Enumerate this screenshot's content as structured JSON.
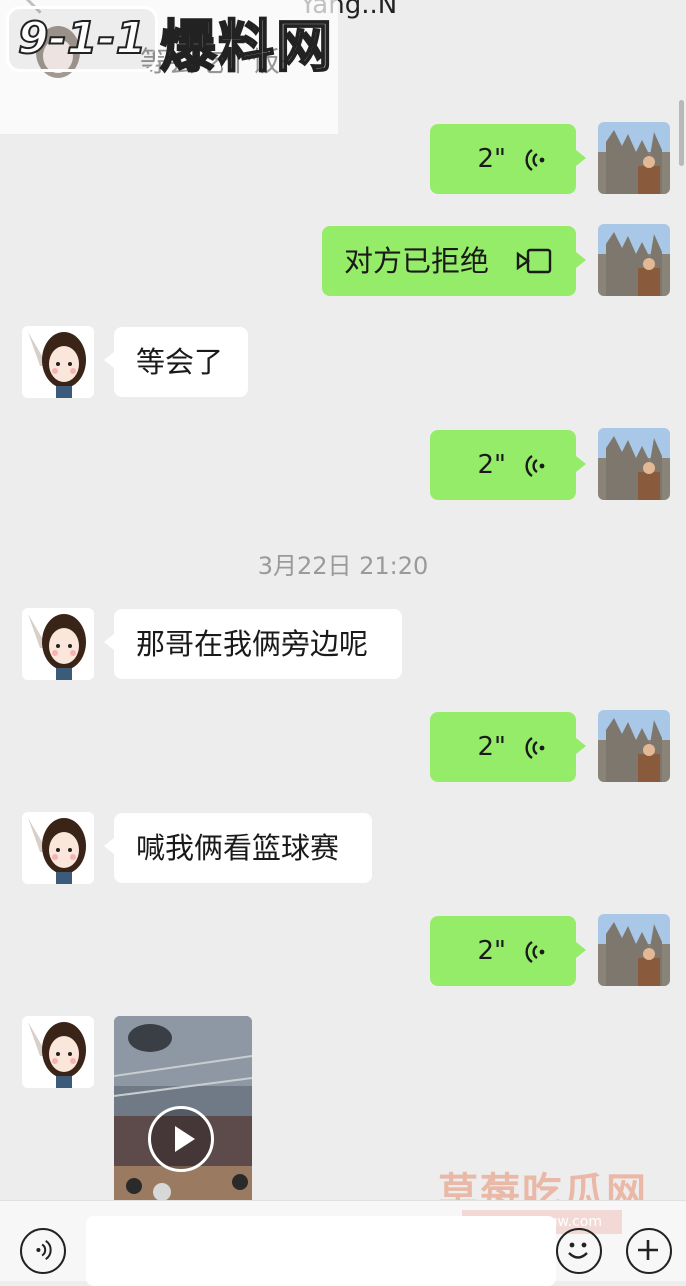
{
  "header": {
    "title": "Yang..N"
  },
  "watermark_top": {
    "logo": "9-1-1",
    "text": "爆料网"
  },
  "faded_message": "等会吃个饭",
  "messages": [
    {
      "side": "right",
      "type": "voice",
      "duration": "2\""
    },
    {
      "side": "right",
      "type": "call",
      "text": "对方已拒绝"
    },
    {
      "side": "left",
      "type": "text",
      "text": "等会了"
    },
    {
      "side": "right",
      "type": "voice",
      "duration": "2\""
    },
    {
      "type": "timestamp",
      "text": "3月22日 21:20"
    },
    {
      "side": "left",
      "type": "text",
      "text": "那哥在我俩旁边呢"
    },
    {
      "side": "right",
      "type": "voice",
      "duration": "2\""
    },
    {
      "side": "left",
      "type": "text",
      "text": "喊我俩看篮球赛"
    },
    {
      "side": "right",
      "type": "voice",
      "duration": "2\""
    },
    {
      "side": "left",
      "type": "video"
    }
  ],
  "watermark_bottom": {
    "text": "草莓吃瓜网",
    "url": "www.cmcgw.com"
  },
  "input": {
    "value": ""
  }
}
